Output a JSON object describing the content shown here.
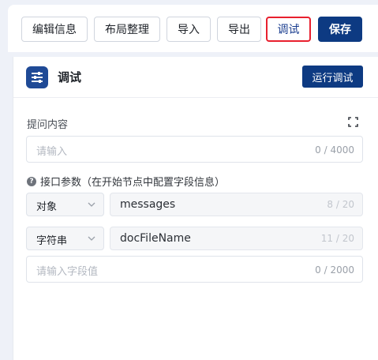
{
  "toolbar": {
    "edit_info": "编辑信息",
    "layout": "布局整理",
    "import": "导入",
    "export": "导出",
    "debug": "调试",
    "save": "保存"
  },
  "panel": {
    "title": "调试",
    "run_button": "运行调试",
    "question_label": "提问内容",
    "question_placeholder": "请输入",
    "question_counter": "0 / 4000",
    "params_hint": "接口参数（在开始节点中配置字段信息）",
    "params": [
      {
        "type": "对象",
        "name": "messages",
        "counter": "8 / 20"
      },
      {
        "type": "字符串",
        "name": "docFileName",
        "counter": "11 / 20"
      }
    ],
    "value_placeholder": "请输入字段值",
    "value_counter": "0 / 2000"
  },
  "colors": {
    "brand": "#0d3a82",
    "active_outline": "#e8202e"
  },
  "icons": {
    "header": "sliders-icon",
    "fullscreen": "fullscreen-icon",
    "help": "question-circle-icon",
    "dropdown": "chevron-down-icon"
  }
}
